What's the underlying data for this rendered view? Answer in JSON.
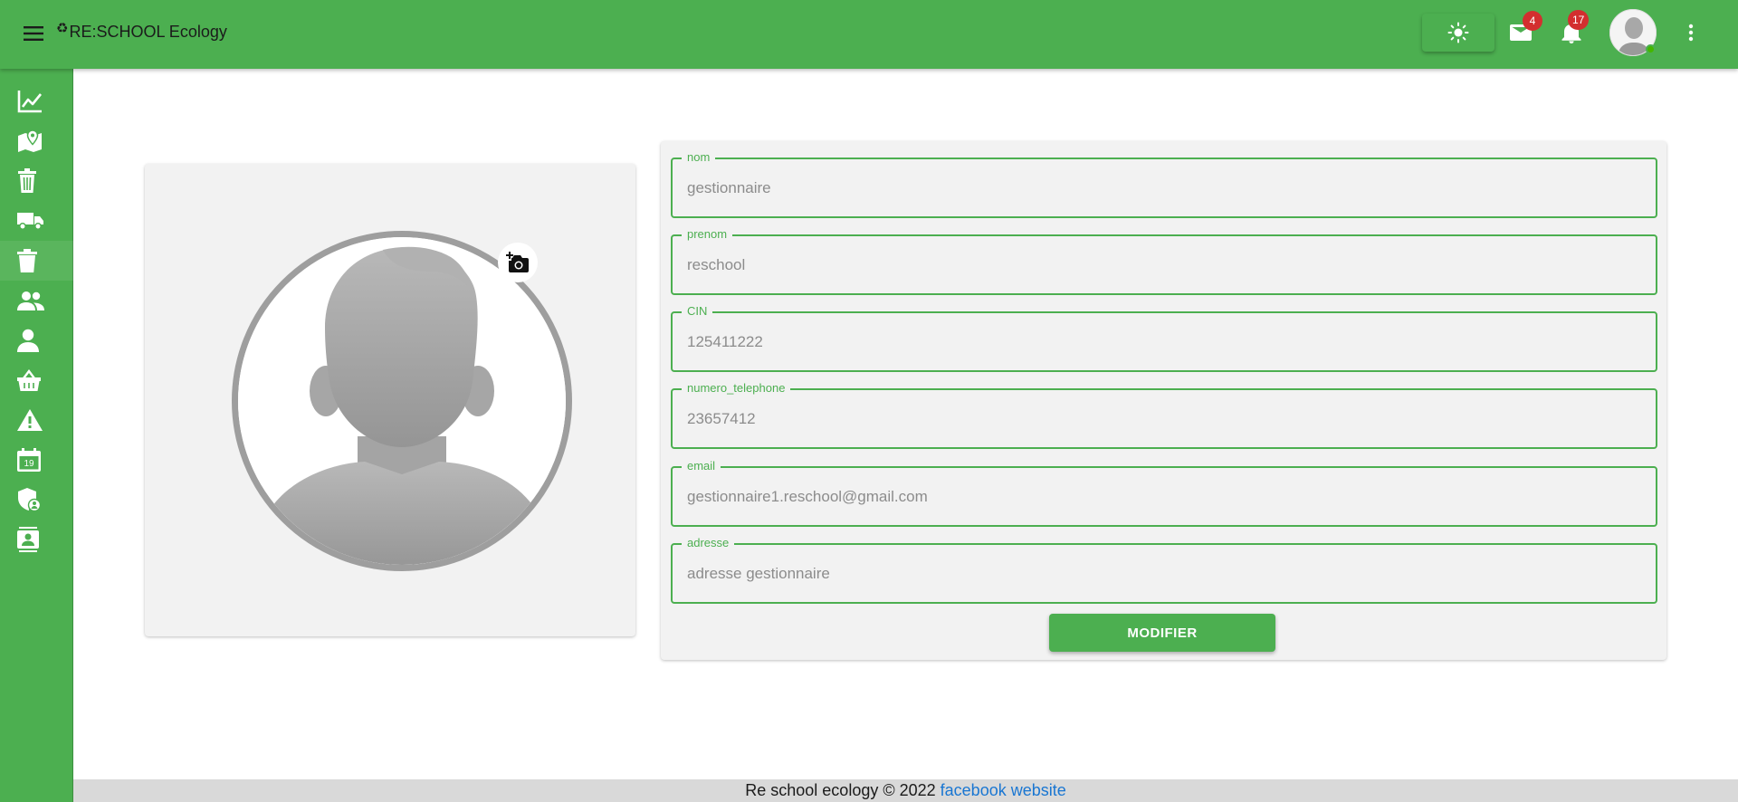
{
  "app": {
    "logo_symbol": "♻",
    "title": "RE:SCHOOL Ecology"
  },
  "header": {
    "messages_count": "4",
    "notifications_count": "17"
  },
  "sidebar": {
    "items": [
      {
        "icon": "chart-line-icon"
      },
      {
        "icon": "map-marker-icon"
      },
      {
        "icon": "trash-can-icon"
      },
      {
        "icon": "truck-icon"
      },
      {
        "icon": "delete-bin-icon"
      },
      {
        "icon": "people-icon"
      },
      {
        "icon": "person-icon"
      },
      {
        "icon": "basket-icon"
      },
      {
        "icon": "warning-icon"
      },
      {
        "icon": "calendar-icon"
      },
      {
        "icon": "shield-user-icon"
      },
      {
        "icon": "contact-card-icon"
      }
    ]
  },
  "calendar_day": "19",
  "form": {
    "fields": [
      {
        "label": "nom",
        "placeholder": "gestionnaire"
      },
      {
        "label": "prenom",
        "placeholder": "reschool"
      },
      {
        "label": "CIN",
        "placeholder": "125411222"
      },
      {
        "label": "numero_telephone",
        "placeholder": "23657412"
      },
      {
        "label": "email",
        "placeholder": "gestionnaire1.reschool@gmail.com"
      },
      {
        "label": "adresse",
        "placeholder": "adresse gestionnaire"
      }
    ],
    "submit_label": "MODIFIER"
  },
  "footer": {
    "text": "Re school ecology © 2022",
    "link1": "facebook",
    "link2": "website"
  },
  "colors": {
    "primary": "#4caf50",
    "badge": "#d32f2f",
    "link": "#1976d2"
  }
}
